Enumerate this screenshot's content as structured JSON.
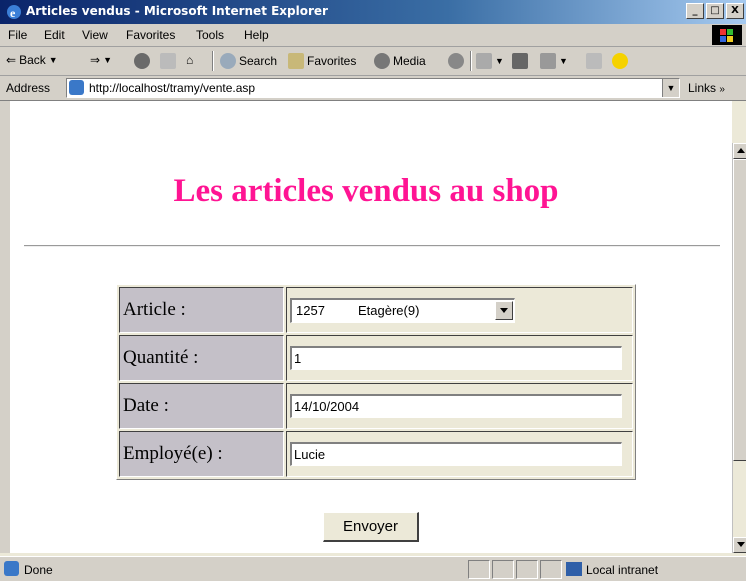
{
  "window": {
    "title": "Articles vendus - Microsoft Internet Explorer",
    "controls": {
      "minimize": "_",
      "maximize": "□",
      "close": "X"
    }
  },
  "menu": [
    "File",
    "Edit",
    "View",
    "Favorites",
    "Tools",
    "Help"
  ],
  "toolbar": {
    "back": "Back",
    "search": "Search",
    "favorites": "Favorites",
    "media": "Media"
  },
  "address": {
    "label": "Address",
    "url": "http://localhost/tramy/vente.asp",
    "links": "Links"
  },
  "page": {
    "heading": "Les articles vendus au shop",
    "heading_color": "#ff1493",
    "form": {
      "article_label": "Article :",
      "article_code": "1257",
      "article_name": "Etagère(9)",
      "quantite_label": "Quantité :",
      "quantite_value": "1",
      "date_label": "Date :",
      "date_value": "14/10/2004",
      "employe_label": "Employé(e) :",
      "employe_value": "Lucie",
      "submit_label": "Envoyer"
    }
  },
  "status": {
    "text": "Done",
    "zone": "Local intranet"
  }
}
